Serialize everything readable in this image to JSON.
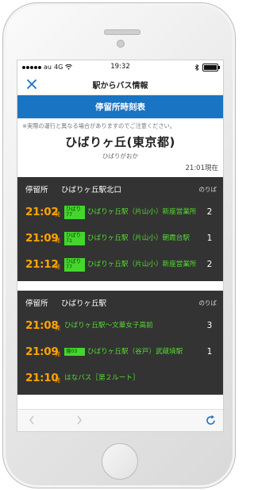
{
  "status": {
    "carrier": "au",
    "network": "4G",
    "time": "19:32"
  },
  "nav": {
    "title": "駅からバス情報"
  },
  "banner": {
    "title": "停留所時刻表"
  },
  "notice": "※実際の運行と異なる場合がありますのでご注意ください。",
  "station": {
    "name": "ひばりヶ丘(東京都)",
    "kana": "ひばりがおか",
    "as_of": "21:01現在"
  },
  "boards": [
    {
      "label": "停留所",
      "stop": "ひばりヶ丘駅北口",
      "platform_header": "のりば",
      "departures": [
        {
          "time": "21:02",
          "suffix": "発",
          "route": "ひばり77",
          "dest": "ひばりヶ丘駅（片山小）新座営業所",
          "platform": "2"
        },
        {
          "time": "21:09",
          "suffix": "発",
          "route": "ひばり71",
          "dest": "ひばりヶ丘駅（片山小）朝霞台駅",
          "platform": "1"
        },
        {
          "time": "21:12",
          "suffix": "発",
          "route": "ひばり77",
          "dest": "ひばりヶ丘駅（片山小）新座営業所",
          "platform": "2"
        }
      ]
    },
    {
      "label": "停留所",
      "stop": "ひばりヶ丘駅",
      "platform_header": "のりば",
      "departures": [
        {
          "time": "21:08",
          "suffix": "発",
          "route": "",
          "dest": "ひばりヶ丘駅〜文華女子高前",
          "platform": "3"
        },
        {
          "time": "21:09",
          "suffix": "発",
          "route": "境03",
          "dest": "ひばりヶ丘駅（谷戸）武蔵境駅",
          "platform": "1"
        },
        {
          "time": "21:10",
          "suffix": "発",
          "route": "",
          "dest": "はなバス［第２ルート］",
          "platform": ""
        }
      ]
    }
  ],
  "icons": {
    "close": "close-icon",
    "back": "chevron-left-icon",
    "forward": "chevron-right-icon",
    "reload": "refresh-icon"
  },
  "colors": {
    "accent": "#1a74c4",
    "time": "#ffa400",
    "route": "#44d62c",
    "board": "#333333"
  }
}
